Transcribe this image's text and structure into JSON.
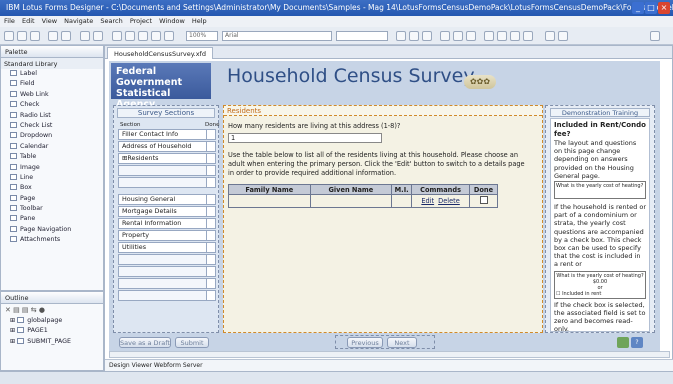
{
  "window": {
    "title": "IBM Lotus Forms Designer - C:\\Documents and Settings\\Administrator\\My Documents\\Samples - Mag 14\\LotusFormsCensusDemoPack\\LotusFormsCensusDemoPack\\Forms\\HouseholdCensu..."
  },
  "menu": [
    "File",
    "Edit",
    "View",
    "Navigate",
    "Search",
    "Project",
    "Window",
    "Help"
  ],
  "toolbar": {
    "zoom": "100%",
    "font": "Arial"
  },
  "palette": {
    "title": "Palette",
    "library": "Standard Library",
    "items": [
      "Label",
      "Field",
      "Web Link",
      "Check",
      "Radio List",
      "Check List",
      "Dropdown",
      "Calendar",
      "Table",
      "Image",
      "Line",
      "Box",
      "Page",
      "Toolbar",
      "Pane",
      "Page Navigation",
      "Attachments"
    ]
  },
  "outline": {
    "title": "Outline",
    "items": [
      "globalpage",
      "PAGE1",
      "SUBMIT_PAGE"
    ]
  },
  "editor": {
    "tab": "HouseholdCensusSurvey.xfd",
    "bottom_tabs": "Design  Viewer  Webform Server"
  },
  "form": {
    "agency": "Federal Government Statistical Agency",
    "title": "Household Census Survey",
    "sections": {
      "title": "Survey Sections",
      "col_section": "Section",
      "col_done": "Done",
      "items": [
        "Filler Contact Info",
        "Address of Household",
        "Residents",
        "",
        "",
        "Housing General",
        "Mortgage Details",
        "Rental Information",
        "Property",
        "Utilities",
        "",
        "",
        "",
        ""
      ]
    },
    "main": {
      "header": "Residents",
      "question": "How many residents are living at this address (1-8)?",
      "answer": "1",
      "instructions": "Use the table below to list all of the residents living at this household. Please choose an adult when entering the primary person.  Click the 'Edit' button to switch to a details page in order to provide required additional information.",
      "columns": [
        "Family Name",
        "Given Name",
        "M.I.",
        "Commands",
        "Done"
      ],
      "edit_label": "Edit",
      "delete_label": "Delete"
    },
    "demo": {
      "title": "Demonstration Training",
      "heading": "Included in Rent/Condo fee?",
      "text1": "The layout and questions on this page change depending on answers provided on the Housing General page.",
      "sample_q": "What is the yearly cost of heating?",
      "text2": "If the household is rented or part of a condominium or strata, the yearly cost questions are accompanied by a check box. This check box can be used to specify that the cost is included in a rent or",
      "sample_q2": "What is the yearly cost of heating?",
      "sample_val": "$0.00",
      "or": "or",
      "incl": "Included in rent",
      "text3": "If the check box is selected, the associated field is set to zero and becomes read-only."
    },
    "buttons": {
      "save_draft": "Save as a Draft",
      "submit": "Submit",
      "previous": "Previous",
      "next": "Next"
    }
  }
}
